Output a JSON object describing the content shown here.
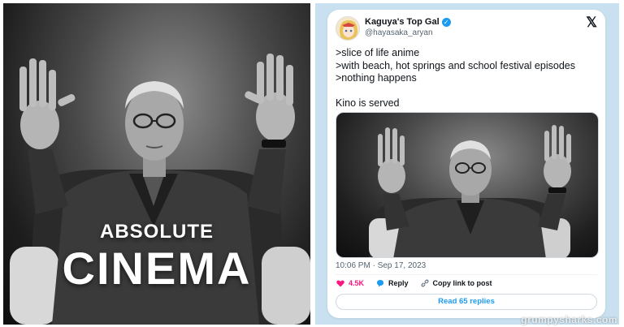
{
  "meme": {
    "caption_top": "ABSOLUTE",
    "caption_bottom": "CINEMA"
  },
  "tweet": {
    "display_name": "Kaguya's Top Gal",
    "handle": "@hayasaka_aryan",
    "verified": true,
    "lines": [
      ">slice of life anime",
      ">with beach, hot springs and school festival episodes",
      ">nothing happens",
      "Kino is served"
    ],
    "timestamp": "10:06 PM · Sep 17, 2023",
    "like_count": "4.5K",
    "reply_label": "Reply",
    "copy_label": "Copy link to post",
    "read_replies_label": "Read 65 replies"
  },
  "watermark": "grumpysharks.com",
  "colors": {
    "verified_blue": "#1d9bf0",
    "like_pink": "#f91880",
    "panel_bg": "#c8e0ef"
  }
}
